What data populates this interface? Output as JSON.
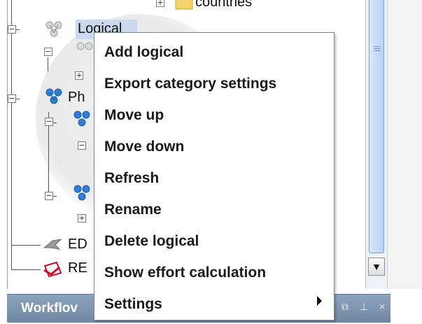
{
  "tree": {
    "nodes": {
      "countries": "countries",
      "logical": "Logical",
      "physical": "Ph",
      "ed": "ED",
      "re": "RE"
    }
  },
  "context_menu": {
    "items": [
      {
        "label": "Add logical"
      },
      {
        "label": "Export category settings"
      },
      {
        "label": "Move up"
      },
      {
        "label": "Move down"
      },
      {
        "label": "Refresh"
      },
      {
        "label": "Rename"
      },
      {
        "label": "Delete logical"
      },
      {
        "label": "Show effort calculation"
      },
      {
        "label": "Settings",
        "has_submenu": true
      }
    ]
  },
  "workflow": {
    "title": "Workflov",
    "controls": "⧉ ⊥ ×"
  },
  "scrollbar": {
    "down_arrow": "▼"
  },
  "colors": {
    "selection": "#cbd9ee",
    "workflow_bar": "#7c94ae",
    "scroll_thumb": "#c8dcf6"
  }
}
